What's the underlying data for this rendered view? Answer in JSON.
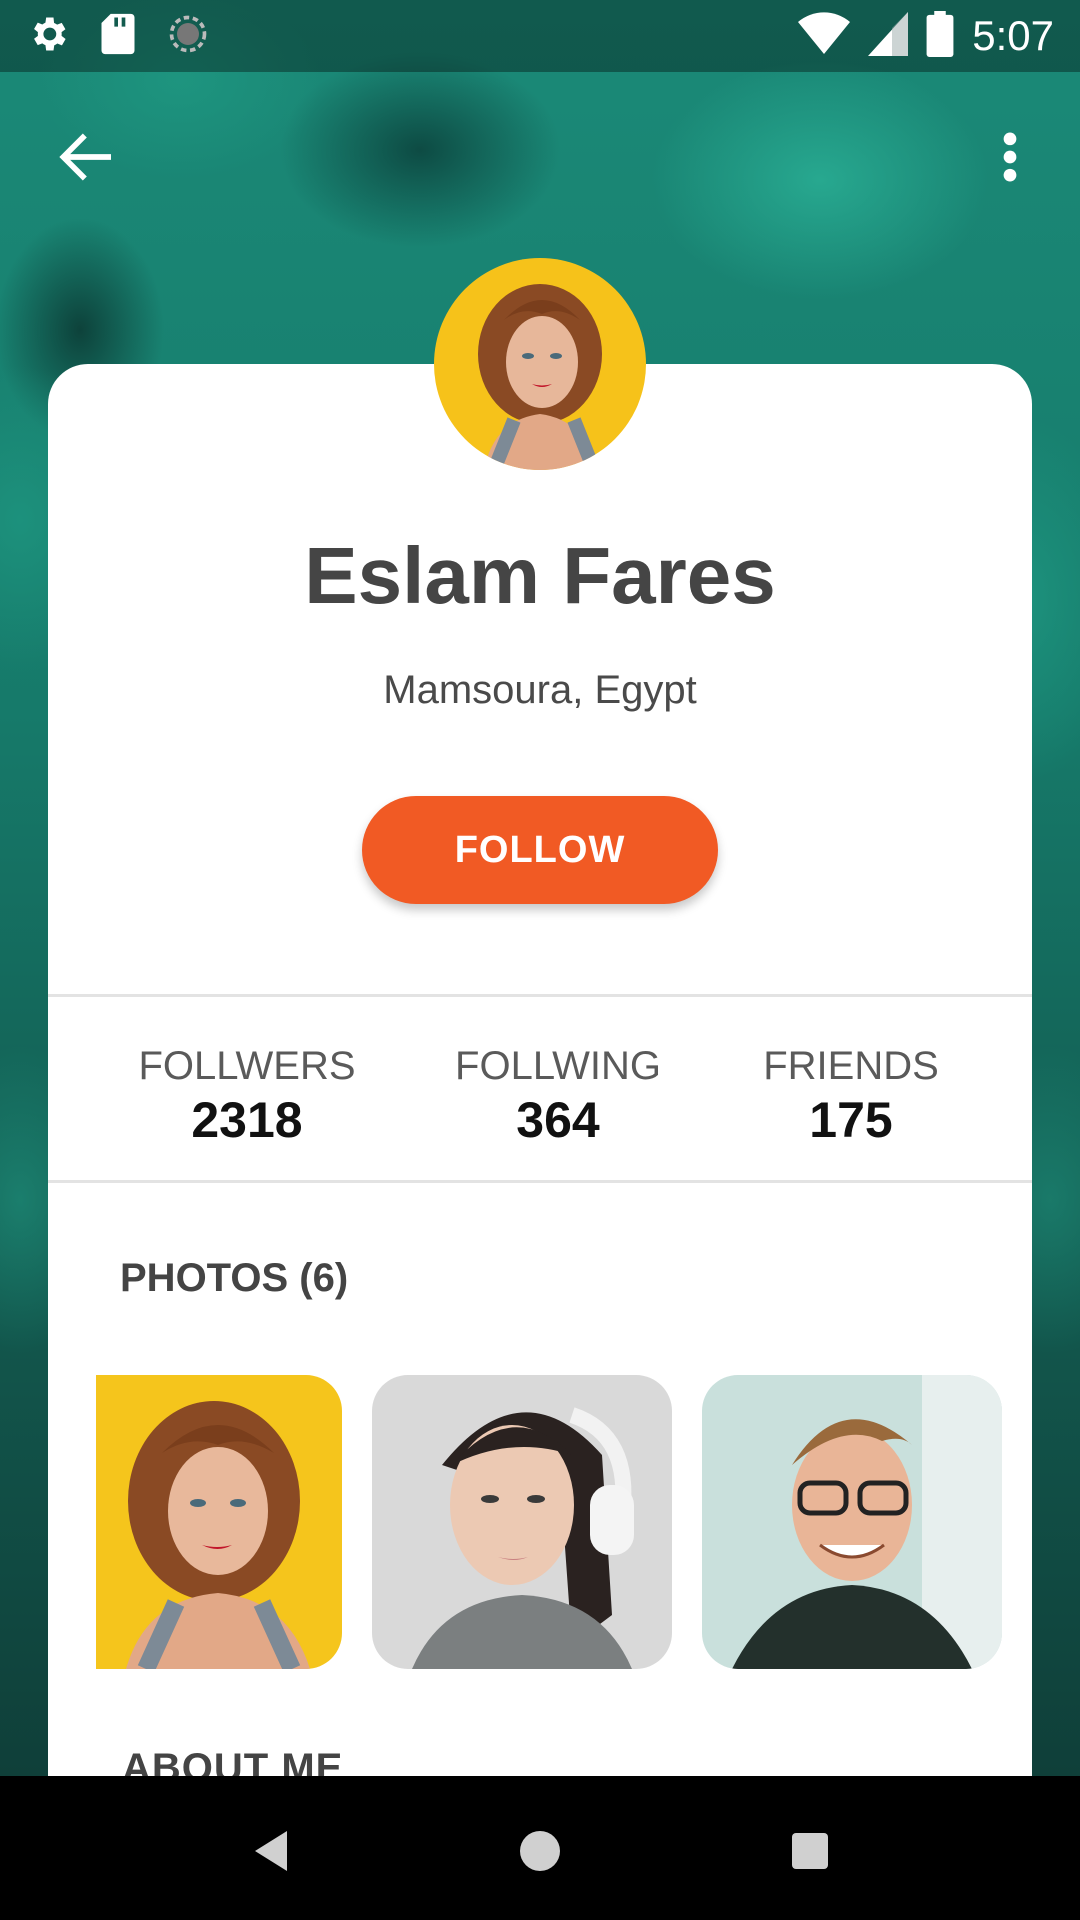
{
  "status_bar": {
    "time": "5:07",
    "icons_left": [
      "settings-icon",
      "sd-card-icon",
      "sync-icon"
    ],
    "icons_right": [
      "wifi-icon",
      "cell-signal-icon",
      "battery-icon"
    ]
  },
  "app_bar": {
    "back_icon": "arrow-back-icon",
    "menu_icon": "more-vert-icon"
  },
  "profile": {
    "name": "Eslam Fares",
    "location": "Mamsoura, Egypt",
    "follow_label": "FOLLOW"
  },
  "stats": [
    {
      "label": "FOLLWERS",
      "value": "2318"
    },
    {
      "label": "FOLLWING",
      "value": "364"
    },
    {
      "label": "FRIENDS",
      "value": "175"
    }
  ],
  "photos": {
    "title": "PHOTOS (6)"
  },
  "about": {
    "title": "ABOUT ME"
  },
  "nav_bar": {
    "icons": [
      "nav-back-icon",
      "nav-home-icon",
      "nav-recents-icon"
    ]
  },
  "colors": {
    "accent": "#f15a24",
    "background_teal": "#1b8a78",
    "card": "#ffffff"
  }
}
